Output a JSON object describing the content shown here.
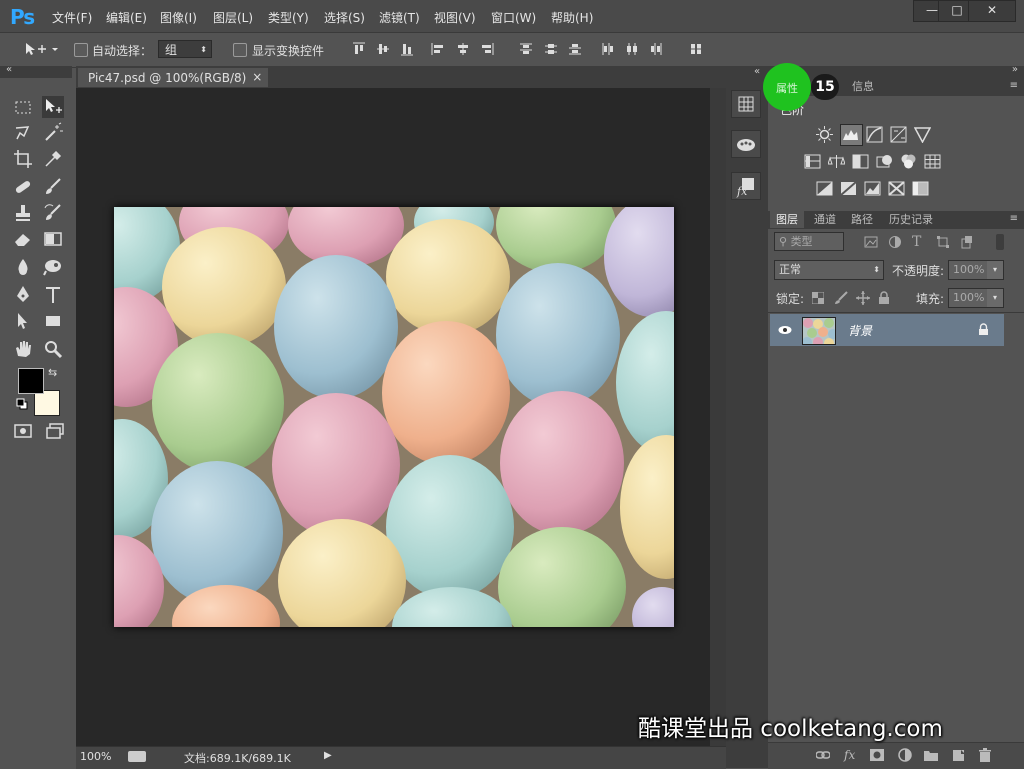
{
  "app": {
    "logo": "Ps"
  },
  "menu": [
    "文件(F)",
    "编辑(E)",
    "图像(I)",
    "图层(L)",
    "类型(Y)",
    "选择(S)",
    "滤镜(T)",
    "视图(V)",
    "窗口(W)",
    "帮助(H)"
  ],
  "window_controls": {
    "minimize": "—",
    "maximize": "□",
    "close": "✕"
  },
  "options": {
    "auto_select_label": "自动选择：",
    "auto_select_value": "组",
    "show_transform_label": "显示变换控件"
  },
  "document": {
    "tab_title": "Pic47.psd @ 100%(RGB/8)",
    "tab_close": "×",
    "zoom": "100%",
    "doc_size": "文档:689.1K/689.1K"
  },
  "properties_panel": {
    "tabs": [
      "属性",
      "信息"
    ],
    "subtitle": "色阶",
    "badge": "15"
  },
  "layers_panel": {
    "tabs": [
      "图层",
      "通道",
      "路径",
      "历史记录"
    ],
    "filter_kind": "类型",
    "blend_mode": "正常",
    "opacity_label": "不透明度:",
    "opacity_value": "100%",
    "lock_label": "锁定:",
    "fill_label": "填充:",
    "fill_value": "100%",
    "layers": [
      {
        "name": "背景",
        "visible": true,
        "locked": true
      }
    ]
  },
  "watermark": "酷课堂出品 coolketang.com",
  "colors": {
    "foreground": "#000000",
    "background": "#fff9e3",
    "accent_green": "#1fc21f",
    "selected_layer": "#6a7b8c"
  }
}
